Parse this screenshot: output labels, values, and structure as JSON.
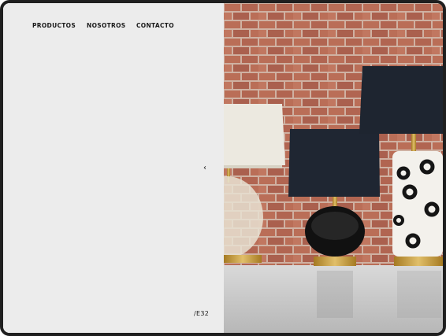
{
  "nav": {
    "items": [
      {
        "label": "PRODUCTOS"
      },
      {
        "label": "NOSOTROS"
      },
      {
        "label": "CONTACTO"
      }
    ]
  },
  "slider": {
    "prev_icon": "chevron-left-icon",
    "prev_glyph": "‹",
    "code": "/E32"
  },
  "colors": {
    "panel": "#ececec",
    "text": "#1a1a1a",
    "frame": "#1f1f1f",
    "brick": "#b0553c",
    "shade_dark": "#1e2530",
    "shade_light": "#ebe8df",
    "brass": "#c59a3a"
  }
}
